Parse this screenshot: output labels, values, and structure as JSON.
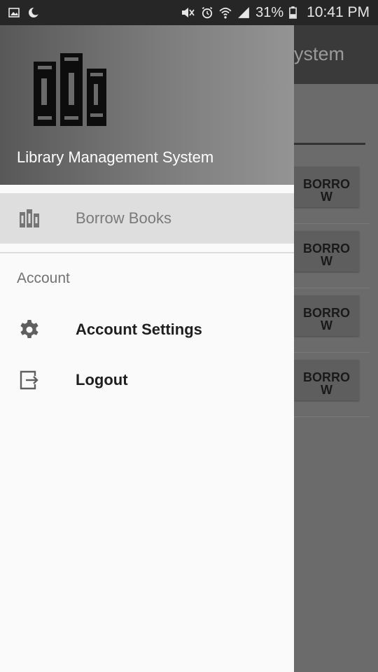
{
  "status_bar": {
    "battery": "31%",
    "time": "10:41 PM"
  },
  "background_app": {
    "title_fragment": "ystem",
    "borrow_buttons": [
      "BORRO\nW",
      "BORRO\nW",
      "BORRO\nW",
      "BORRO\nW"
    ]
  },
  "drawer": {
    "header_title": "Library Management System",
    "nav_items": [
      {
        "label": "Borrow Books",
        "icon": "books-icon",
        "selected": true
      }
    ],
    "account_section": {
      "header": "Account",
      "items": [
        {
          "label": "Account Settings",
          "icon": "gear-icon"
        },
        {
          "label": "Logout",
          "icon": "logout-icon"
        }
      ]
    }
  },
  "colors": {
    "header_dark": "#585858",
    "header_light": "#949494",
    "drawer_bg": "#fafafa",
    "selected_bg": "#dedede"
  }
}
